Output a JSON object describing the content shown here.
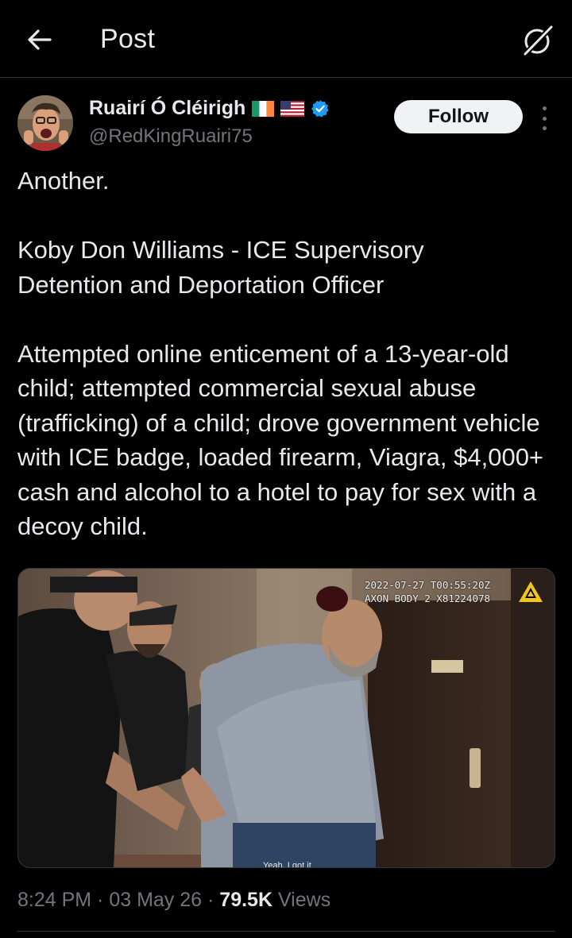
{
  "header": {
    "title": "Post",
    "back_icon": "arrow-left-icon",
    "grok_icon": "grok-icon"
  },
  "author": {
    "display_name": "Ruairí Ó Cléirigh",
    "handle": "@RedKingRuairi75",
    "flags": [
      "flag-ireland-icon",
      "flag-usa-icon"
    ],
    "verified_icon": "verified-badge-icon",
    "verified_color": "#1d9bf0"
  },
  "actions": {
    "follow_label": "Follow",
    "more_icon": "more-vertical-icon"
  },
  "tweet": {
    "line1": "Another.",
    "para2": "Koby Don Williams - ICE Supervisory Detention and Deportation Officer",
    "para3": "Attempted online enticement of a 13-year-old child; attempted commercial sexual abuse (trafficking) of a child; drove government vehicle with ICE badge, loaded firearm, Viagra, $4,000+ cash and alcohol to a hotel to pay for sex with a decoy child."
  },
  "media": {
    "timestamp": "2022-07-27 T00:55:20Z",
    "device": "AXON BODY 2 X81224078",
    "caption": "Yeah, I got it"
  },
  "meta": {
    "time": "8:24 PM",
    "sep1": " · ",
    "date": "03 May 26",
    "sep2": " · ",
    "views_count": "79.5K",
    "views_label": " Views"
  },
  "colors": {
    "background": "#000000",
    "text_primary": "#e7e9ea",
    "text_secondary": "#71767b",
    "divider": "#2f3336",
    "follow_bg": "#eff3f4"
  }
}
